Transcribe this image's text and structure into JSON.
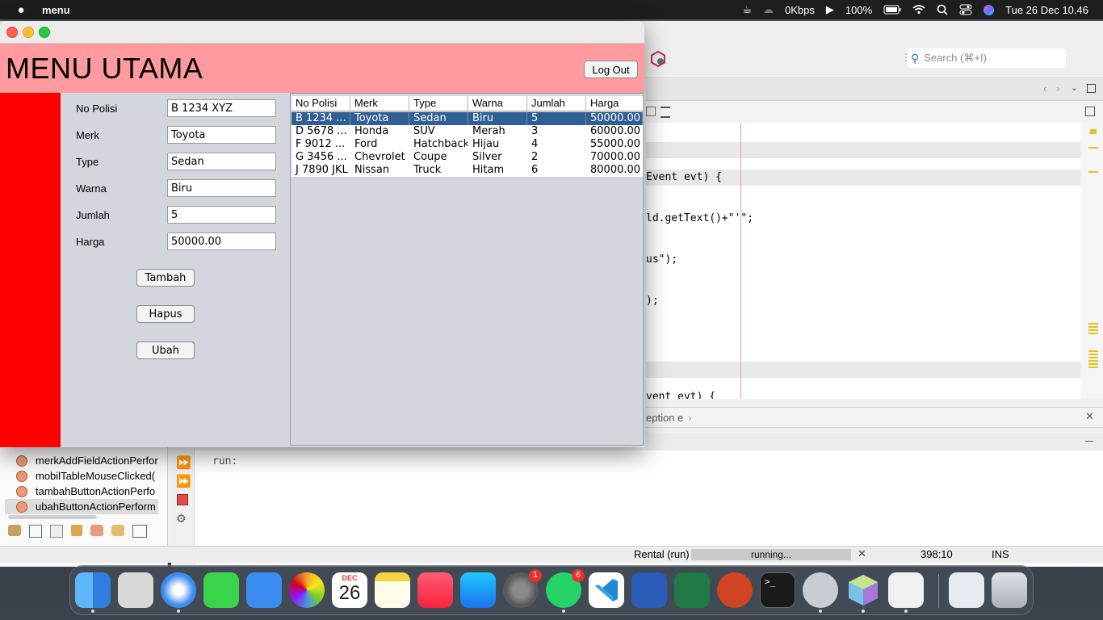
{
  "menubar": {
    "app_name": "menu",
    "network": "0Kbps",
    "battery": "100%",
    "datetime": "Tue 26 Dec  10.46"
  },
  "ide": {
    "search_placeholder": "Search (⌘+I)",
    "code_lines": [
      "Event evt) {",
      "ld.getText()+\"'\";",
      "us\");",
      ");",
      "vent evt) {"
    ],
    "breadcrumb": "eption e",
    "navigator_items": [
      "merkAddFieldActionPerfor",
      "mobilTableMouseClicked(",
      "tambahButtonActionPerfo",
      "ubahButtonActionPerform"
    ],
    "output_text": "run:",
    "status_project": "Rental (run)",
    "status_progress": "running...",
    "status_position": "398:10",
    "status_mode": "INS"
  },
  "app": {
    "title": "MENU UTAMA",
    "logout_label": "Log Out",
    "form": {
      "labels": {
        "no_polisi": "No Polisi",
        "merk": "Merk",
        "type": "Type",
        "warna": "Warna",
        "jumlah": "Jumlah",
        "harga": "Harga"
      },
      "values": {
        "no_polisi": "B 1234 XYZ",
        "merk": "Toyota",
        "type": "Sedan",
        "warna": "Biru",
        "jumlah": "5",
        "harga": "50000.00"
      },
      "buttons": {
        "tambah": "Tambah",
        "hapus": "Hapus",
        "ubah": "Ubah"
      }
    },
    "table": {
      "columns": [
        "No Polisi",
        "Merk",
        "Type",
        "Warna",
        "Jumlah",
        "Harga"
      ],
      "rows": [
        [
          "B 1234 ...",
          "Toyota",
          "Sedan",
          "Biru",
          "5",
          "50000.00"
        ],
        [
          "D 5678 ...",
          "Honda",
          "SUV",
          "Merah",
          "3",
          "60000.00"
        ],
        [
          "F 9012 ...",
          "Ford",
          "Hatchback",
          "Hijau",
          "4",
          "55000.00"
        ],
        [
          "G 3456 ...",
          "Chevrolet",
          "Coupe",
          "Silver",
          "2",
          "70000.00"
        ],
        [
          "J 7890 JKL",
          "Nissan",
          "Truck",
          "Hitam",
          "6",
          "80000.00"
        ]
      ],
      "selected_row": 0
    }
  },
  "dock": {
    "calendar_month": "DEC",
    "calendar_day": "26",
    "settings_badge": "1",
    "whatsapp_badge": "6"
  },
  "colors": {
    "header": "#ff9a9f",
    "side_bar": "#ff0000",
    "selection": "#2f5f95"
  }
}
